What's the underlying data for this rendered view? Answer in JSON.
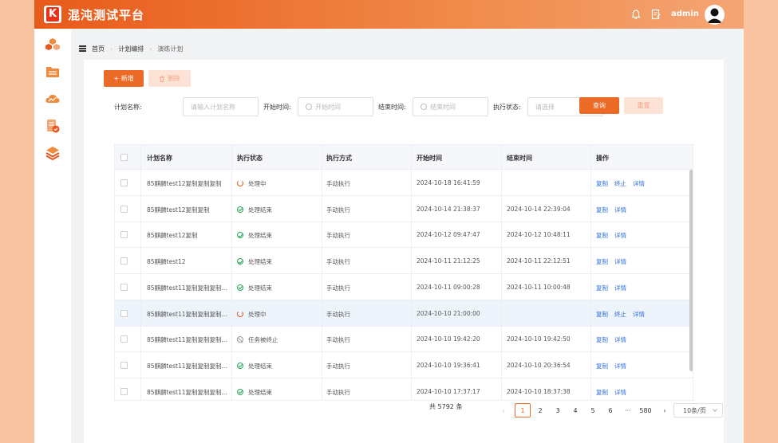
{
  "app": {
    "title": "混沌测试平台",
    "logo_letter": "K",
    "username": "admin"
  },
  "colors": {
    "accent": "#ea6a26",
    "link": "#2f6fd6",
    "success": "#2aa85a",
    "running": "#e8561e"
  },
  "sidebar": {
    "items": [
      {
        "icon": "cubes-icon"
      },
      {
        "icon": "folder-list-icon"
      },
      {
        "icon": "cloud-chart-icon"
      },
      {
        "icon": "document-check-icon"
      },
      {
        "icon": "layers-icon"
      }
    ]
  },
  "breadcrumb": [
    "首页",
    "计划编排",
    "演练计划"
  ],
  "toolbar": {
    "add_label": "+ 新增",
    "delete_label": "删除"
  },
  "filters": {
    "name_label": "计划名称:",
    "name_placeholder": "请输入计划名称",
    "start_label": "开始时间:",
    "start_placeholder": "开始时间",
    "end_label": "结束时间:",
    "end_placeholder": "结束时间",
    "status_label": "执行状态:",
    "status_placeholder": "请选择",
    "query_label": "查询",
    "reset_label": "重置"
  },
  "table": {
    "headers": [
      "计划名称",
      "执行状态",
      "执行方式",
      "开始时间",
      "结束时间",
      "操作"
    ],
    "rows": [
      {
        "name": "85麒麟test12复制复制复制",
        "status": "处理中",
        "status_type": "running",
        "mode": "手动执行",
        "start": "2024-10-18 16:41:59",
        "end": "",
        "actions": [
          "复制",
          "终止",
          "详情"
        ]
      },
      {
        "name": "85麒麟test12复制复制",
        "status": "处理结束",
        "status_type": "done",
        "mode": "手动执行",
        "start": "2024-10-14 21:38:37",
        "end": "2024-10-14 22:39:04",
        "actions": [
          "复制",
          "详情"
        ]
      },
      {
        "name": "85麒麟test12复制",
        "status": "处理结束",
        "status_type": "done",
        "mode": "手动执行",
        "start": "2024-10-12 09:47:47",
        "end": "2024-10-12 10:48:11",
        "actions": [
          "复制",
          "详情"
        ]
      },
      {
        "name": "85麒麟test12",
        "status": "处理结束",
        "status_type": "done",
        "mode": "手动执行",
        "start": "2024-10-11 21:12:25",
        "end": "2024-10-11 22:12:51",
        "actions": [
          "复制",
          "详情"
        ]
      },
      {
        "name": "85麒麟test11复制复制复制...",
        "status": "处理结束",
        "status_type": "done",
        "mode": "手动执行",
        "start": "2024-10-11 09:00:28",
        "end": "2024-10-11 10:00:48",
        "actions": [
          "复制",
          "详情"
        ]
      },
      {
        "name": "85麒麟test11复制复制复制...",
        "status": "处理中",
        "status_type": "running",
        "mode": "手动执行",
        "start": "2024-10-10 21:00:00",
        "end": "",
        "actions": [
          "复制",
          "终止",
          "详情"
        ]
      },
      {
        "name": "85麒麟test11复制复制复制...",
        "status": "任务被终止",
        "status_type": "stopped",
        "mode": "手动执行",
        "start": "2024-10-10 19:42:20",
        "end": "2024-10-10 19:42:50",
        "actions": [
          "复制",
          "详情"
        ]
      },
      {
        "name": "85麒麟test11复制复制复制...",
        "status": "处理结束",
        "status_type": "done",
        "mode": "手动执行",
        "start": "2024-10-10 19:36:41",
        "end": "2024-10-10 20:36:54",
        "actions": [
          "复制",
          "详情"
        ]
      },
      {
        "name": "85麒麟test11复制复制复制...",
        "status": "处理结束",
        "status_type": "done",
        "mode": "手动执行",
        "start": "2024-10-10 17:37:17",
        "end": "2024-10-10 18:37:38",
        "actions": [
          "复制",
          "详情"
        ]
      }
    ]
  },
  "pagination": {
    "total_text": "共 5792 条",
    "pages": [
      "1",
      "2",
      "3",
      "4",
      "5",
      "6"
    ],
    "ellipsis": "···",
    "last_page": "580",
    "current": "1",
    "page_size": "10条/页"
  }
}
